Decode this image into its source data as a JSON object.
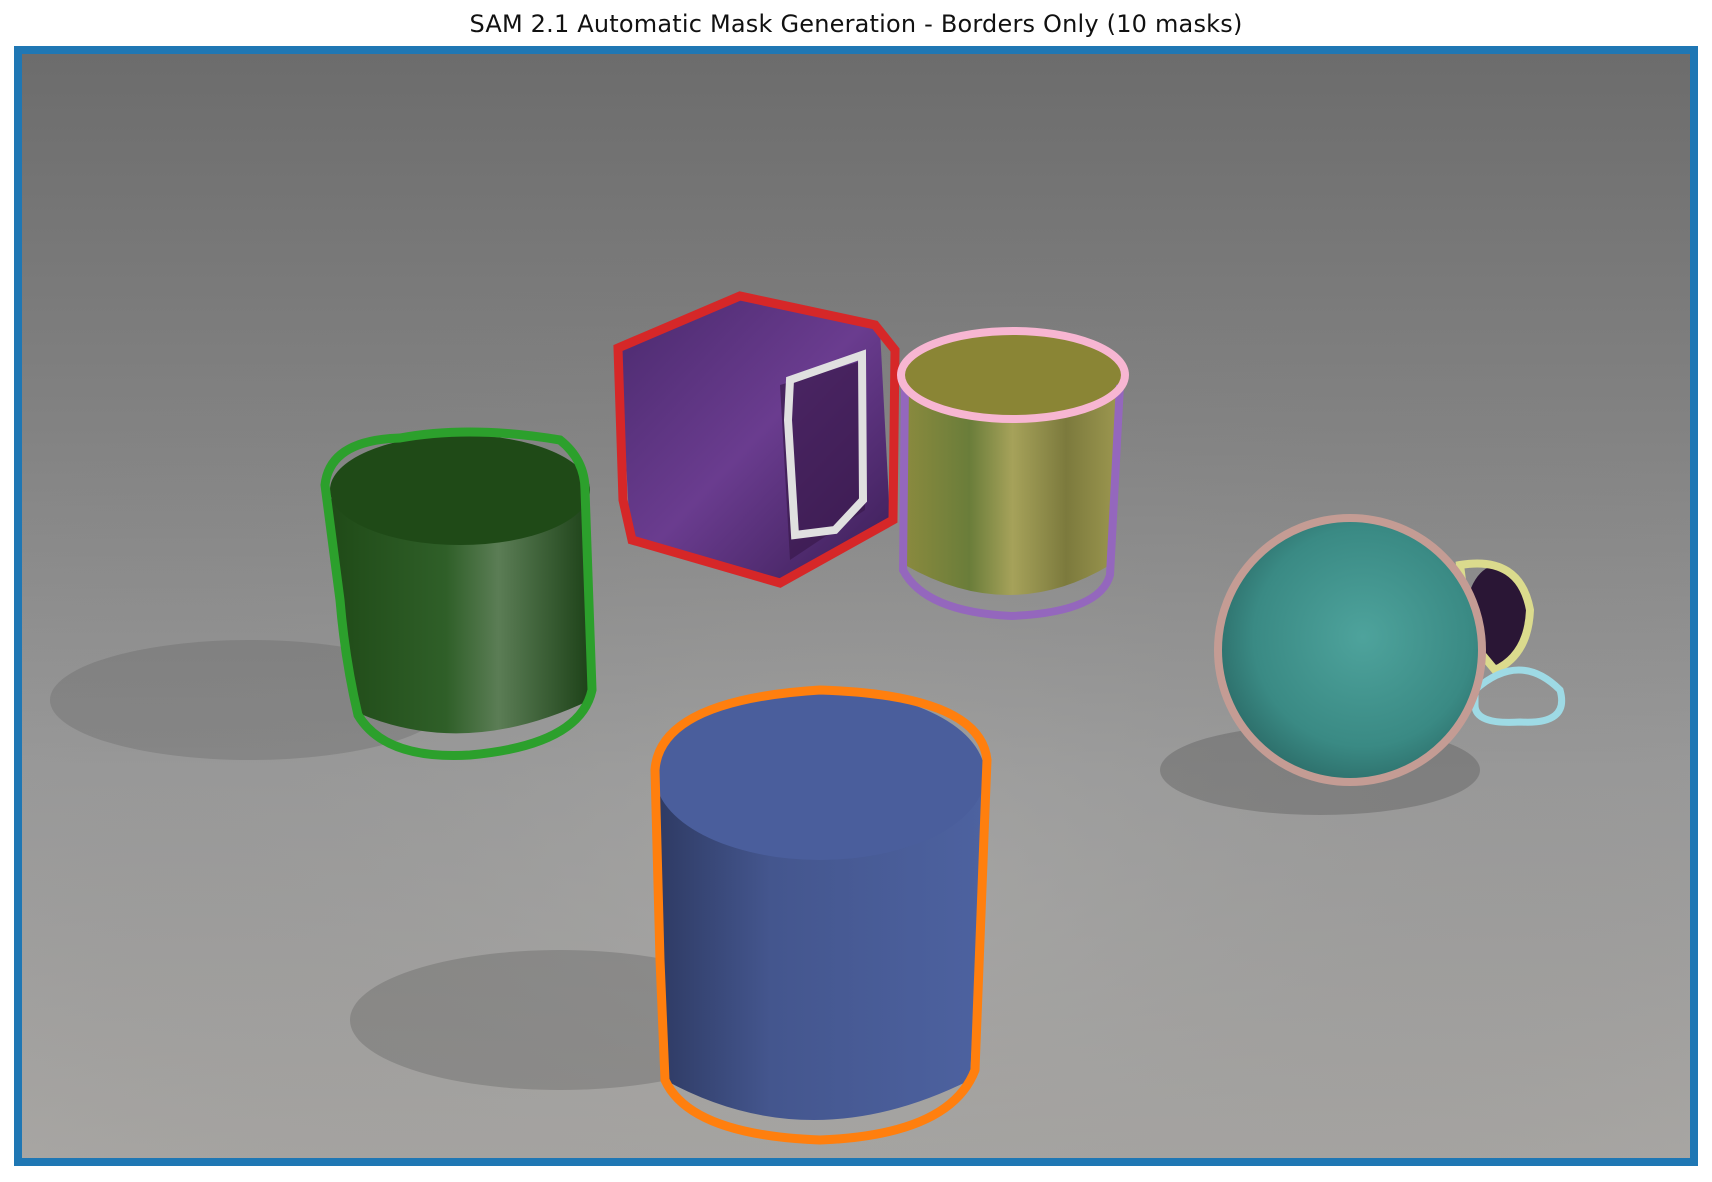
{
  "figure": {
    "title": "SAM 2.1 Automatic Mask Generation - Borders Only (10 masks)"
  },
  "colors": {
    "background_border": "#1f77b4",
    "green_cylinder_border": "#2ca02c",
    "purple_cube_border": "#d62728",
    "cube_face_border": "#e0e0e0",
    "gold_cylinder_top_border": "#f7b6d2",
    "gold_cylinder_body_border": "#9467bd",
    "blue_cylinder_border": "#ff7f0e",
    "teal_sphere_border": "#c49c94",
    "small_object_border": "#dbdb8d",
    "small_shadow_border": "#9edae5"
  },
  "objects": [
    {
      "name": "green-cylinder",
      "material": "metal",
      "color": "green"
    },
    {
      "name": "purple-cube",
      "material": "metal",
      "color": "purple"
    },
    {
      "name": "gold-cylinder",
      "material": "metal",
      "color": "yellow"
    },
    {
      "name": "blue-cylinder",
      "material": "rubber",
      "color": "blue"
    },
    {
      "name": "teal-sphere",
      "material": "rubber",
      "color": "cyan"
    },
    {
      "name": "small-purple-object",
      "material": "metal",
      "color": "purple"
    }
  ]
}
